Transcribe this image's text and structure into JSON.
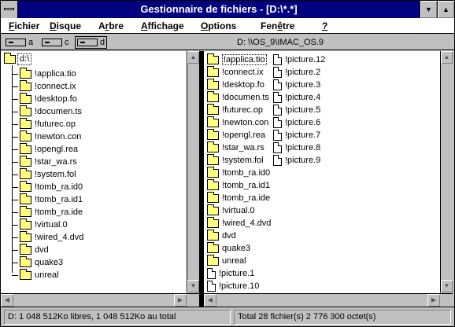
{
  "window": {
    "title": "Gestionnaire de fichiers - [D:\\*.*]"
  },
  "menu": [
    {
      "label": "Fichier",
      "u": "F",
      "rest": "ichier"
    },
    {
      "label": "Disque",
      "u": "D",
      "rest": "isque"
    },
    {
      "label": "Arbre",
      "u": "r",
      "pre": "A",
      "rest": "bre"
    },
    {
      "label": "Affichage",
      "u": "A",
      "rest": "ffichage"
    },
    {
      "label": "Options",
      "u": "O",
      "rest": "ptions"
    },
    {
      "label": "Fenêtre",
      "u": "ê",
      "pre": "Fen",
      "rest": "tre"
    },
    {
      "label": "?",
      "u": "?",
      "rest": ""
    }
  ],
  "drives": [
    {
      "letter": "a",
      "icon": "floppy-drive-icon"
    },
    {
      "letter": "c",
      "icon": "hard-drive-icon"
    },
    {
      "letter": "d",
      "icon": "network-drive-icon",
      "selected": true
    }
  ],
  "path": "D: \\\\OS_9\\IMAC_OS.9",
  "tree": {
    "root": "d:\\",
    "items": [
      "!applica.tio",
      "!connect.ix",
      "!desktop.fo",
      "!documen.ts",
      "!futurec.op",
      "!newton.con",
      "!opengl.rea",
      "!star_wa.rs",
      "!system.fol",
      "!tomb_ra.id0",
      "!tomb_ra.id1",
      "!tomb_ra.ide",
      "!virtual.0",
      "!wired_4.dvd",
      "dvd",
      "quake3",
      "unreal"
    ]
  },
  "files": {
    "col1": [
      {
        "name": "!applica.tio",
        "type": "folder"
      },
      {
        "name": "!connect.ix",
        "type": "folder"
      },
      {
        "name": "!desktop.fo",
        "type": "folder"
      },
      {
        "name": "!documen.ts",
        "type": "folder"
      },
      {
        "name": "!futurec.op",
        "type": "folder"
      },
      {
        "name": "!newton.con",
        "type": "folder"
      },
      {
        "name": "!opengl.rea",
        "type": "folder"
      },
      {
        "name": "!star_wa.rs",
        "type": "folder"
      },
      {
        "name": "!system.fol",
        "type": "folder"
      },
      {
        "name": "!tomb_ra.id0",
        "type": "folder"
      },
      {
        "name": "!tomb_ra.id1",
        "type": "folder"
      },
      {
        "name": "!tomb_ra.ide",
        "type": "folder"
      },
      {
        "name": "!virtual.0",
        "type": "folder"
      },
      {
        "name": "!wired_4.dvd",
        "type": "folder"
      },
      {
        "name": "dvd",
        "type": "folder"
      },
      {
        "name": "quake3",
        "type": "folder"
      },
      {
        "name": "unreal",
        "type": "folder"
      },
      {
        "name": "!picture.1",
        "type": "file"
      },
      {
        "name": "!picture.10",
        "type": "file"
      }
    ],
    "col2": [
      {
        "name": "!picture.12",
        "type": "file"
      },
      {
        "name": "!picture.2",
        "type": "file"
      },
      {
        "name": "!picture.3",
        "type": "file"
      },
      {
        "name": "!picture.4",
        "type": "file"
      },
      {
        "name": "!picture.5",
        "type": "file"
      },
      {
        "name": "!picture.6",
        "type": "file"
      },
      {
        "name": "!picture.7",
        "type": "file"
      },
      {
        "name": "!picture.8",
        "type": "file"
      },
      {
        "name": "!picture.9",
        "type": "file"
      }
    ]
  },
  "status": {
    "left": "D: 1 048 512Ko libres,  1 048 512Ko au total",
    "right": "Total 28 fichier(s) 2 776 300 octet(s)"
  }
}
